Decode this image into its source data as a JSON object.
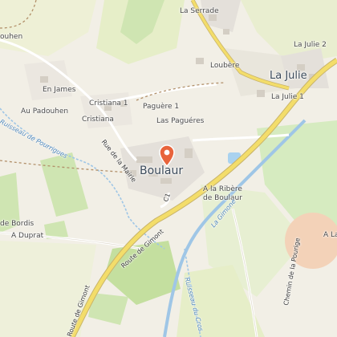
{
  "places": {
    "la_serrade": "La Serrade",
    "boulaur": "Boulaur",
    "la_julie": "La Julie",
    "la_julie_1": "La Julie 1",
    "la_julie_2": "La Julie 2",
    "loubere": "Loubère",
    "en_james": "En James",
    "au_padouhen": "Au Padouhen",
    "padouhen_top": "ouhen",
    "cristiana": "Cristiana",
    "cristiana_1": "Cristiana 1",
    "paguere_1": "Paguère 1",
    "las_pagueres": "Las Paguéres",
    "a_la_ribere": "A la Ribère",
    "de_boulaur": "de Boulaur",
    "a_duprat": "A Duprat",
    "de_bordis": "de Bordis",
    "a_la_right": "A La"
  },
  "roads": {
    "route_gimont": "Route de Gimont",
    "rue_mairie": "Rue de la Mairie",
    "chemin_pourige": "Chemin de la Pourige",
    "road_tag_c1": "C1"
  },
  "water": {
    "ruisseau_pourrigues": "Ruisseau de Pourrigues",
    "la_gimone": "La Gimone",
    "ruisseau_cros": "Ruisseau du Cros"
  },
  "colors": {
    "background": "#f2efe6",
    "pin": "#e8643c",
    "road_major": "#f3dd6a",
    "water": "#9fc6e6"
  },
  "icons": {
    "marker": "map-pin-icon"
  }
}
